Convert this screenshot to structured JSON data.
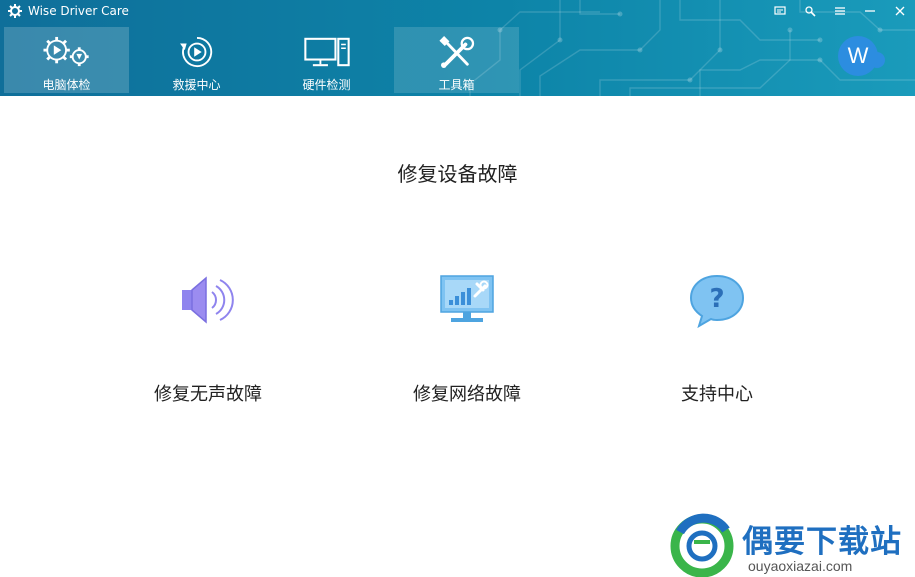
{
  "app": {
    "title": "Wise Driver Care"
  },
  "window_controls": [
    {
      "name": "feedback-icon"
    },
    {
      "name": "settings-wrench-icon"
    },
    {
      "name": "menu-icon"
    },
    {
      "name": "minimize-icon"
    },
    {
      "name": "close-icon"
    }
  ],
  "nav": {
    "tabs": [
      {
        "label": "电脑体检",
        "icon": "gears-icon",
        "state": "active"
      },
      {
        "label": "救援中心",
        "icon": "rescue-icon",
        "state": "normal"
      },
      {
        "label": "硬件检测",
        "icon": "hardware-icon",
        "state": "normal"
      },
      {
        "label": "工具箱",
        "icon": "toolbox-icon",
        "state": "selected"
      }
    ]
  },
  "user": {
    "avatar_letter": "W"
  },
  "main": {
    "title": "修复设备故障",
    "features": [
      {
        "label": "修复无声故障",
        "icon": "speaker-icon"
      },
      {
        "label": "修复网络故障",
        "icon": "network-repair-icon"
      },
      {
        "label": "支持中心",
        "icon": "help-bubble-icon"
      }
    ]
  },
  "watermark": {
    "name": "偶要下载站",
    "url": "ouyaoxiazai.com"
  },
  "colors": {
    "header": "#0d84a8",
    "accent": "#2c8de0",
    "icon_purple": "#9b8cf0",
    "icon_blue": "#7fc3f2"
  }
}
